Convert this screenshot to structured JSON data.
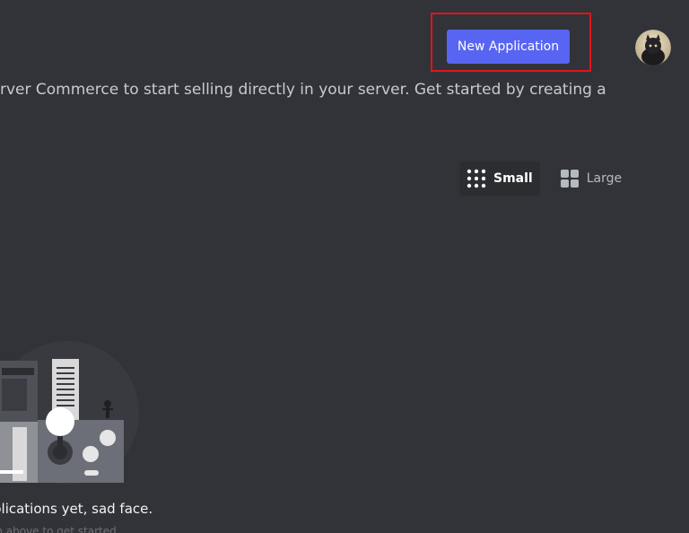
{
  "header": {
    "new_application_label": "New Application"
  },
  "intro": {
    "text": "rver Commerce to start selling directly in your server. Get started by creating a"
  },
  "view_toggle": {
    "small_label": "Small",
    "large_label": "Large",
    "selected": "Small"
  },
  "empty_state": {
    "title": "plications yet, sad face.",
    "subtitle": "on above to get started"
  },
  "colors": {
    "background": "#313338",
    "accent": "#5865f2",
    "highlight": "#e1141d"
  }
}
